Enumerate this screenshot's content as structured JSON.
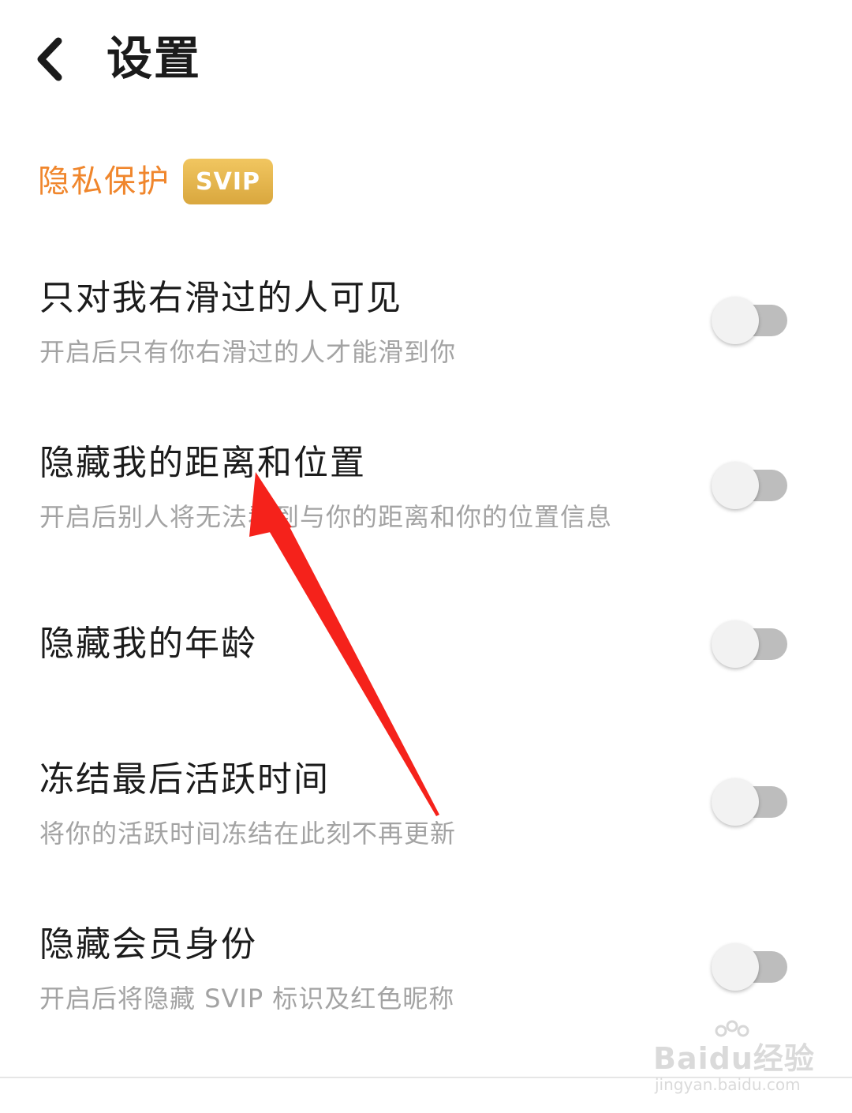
{
  "header": {
    "title": "设置"
  },
  "privacy_section": {
    "title": "隐私保护",
    "badge": "SVIP"
  },
  "settings": [
    {
      "title": "只对我右滑过的人可见",
      "subtitle": "开启后只有你右滑过的人才能滑到你",
      "enabled": false
    },
    {
      "title": "隐藏我的距离和位置",
      "subtitle": "开启后别人将无法看到与你的距离和你的位置信息",
      "enabled": false
    },
    {
      "title": "隐藏我的年龄",
      "subtitle": "",
      "enabled": false
    },
    {
      "title": "冻结最后活跃时间",
      "subtitle": "将你的活跃时间冻结在此刻不再更新",
      "enabled": false
    },
    {
      "title": "隐藏会员身份",
      "subtitle": "开启后将隐藏 SVIP 标识及红色昵称",
      "enabled": false
    }
  ],
  "colors": {
    "accent_orange": "#f0862c",
    "badge_gold": "#d9a73e",
    "annotation_arrow": "#f5221b"
  },
  "watermark": {
    "main": "Baidu经验",
    "url": "jingyan.baidu.com"
  }
}
